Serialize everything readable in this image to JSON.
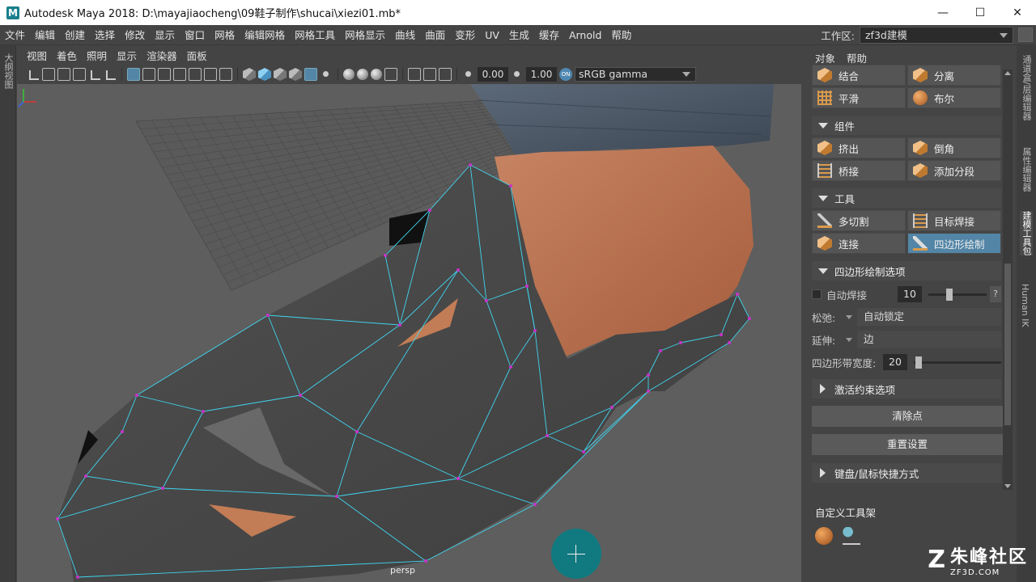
{
  "window": {
    "app_icon": "M",
    "title": "Autodesk Maya 2018: D:\\mayajiaocheng\\09鞋子制作\\shucai\\xiezi01.mb*",
    "controls": [
      "minimize-icon",
      "maximize-icon",
      "close-icon"
    ]
  },
  "menubar": {
    "items": [
      "文件",
      "编辑",
      "创建",
      "选择",
      "修改",
      "显示",
      "窗口",
      "网格",
      "编辑网格",
      "网格工具",
      "网格显示",
      "曲线",
      "曲面",
      "变形",
      "UV",
      "生成",
      "缓存",
      "Arnold",
      "帮助"
    ],
    "workspace_label": "工作区:",
    "workspace_value": "zf3d建模"
  },
  "left_strip": {
    "tab": "大纲视图"
  },
  "viewport": {
    "menu": [
      "视图",
      "着色",
      "照明",
      "显示",
      "渲染器",
      "面板"
    ],
    "exposure": "0.00",
    "gamma": "1.00",
    "color_space": "sRGB gamma",
    "camera_label": "persp"
  },
  "right_panel": {
    "menu": [
      "对象",
      "帮助"
    ],
    "object_tools": [
      {
        "label": "结合",
        "icon": "combine-icon"
      },
      {
        "label": "分离",
        "icon": "separate-icon"
      },
      {
        "label": "平滑",
        "icon": "smooth-icon"
      },
      {
        "label": "布尔",
        "icon": "boolean-icon"
      }
    ],
    "components_title": "组件",
    "component_tools": [
      {
        "label": "挤出",
        "icon": "extrude-icon"
      },
      {
        "label": "倒角",
        "icon": "bevel-icon"
      },
      {
        "label": "桥接",
        "icon": "bridge-icon"
      },
      {
        "label": "添加分段",
        "icon": "add-divisions-icon"
      }
    ],
    "tools_title": "工具",
    "tools": [
      {
        "label": "多切割",
        "icon": "multi-cut-icon"
      },
      {
        "label": "目标焊接",
        "icon": "target-weld-icon"
      },
      {
        "label": "连接",
        "icon": "connect-icon"
      },
      {
        "label": "四边形绘制",
        "icon": "quad-draw-icon",
        "active": true
      }
    ],
    "quad_draw_options_title": "四边形绘制选项",
    "auto_weld": {
      "label": "自动焊接",
      "value": "10",
      "checked": false,
      "slider_fraction": 0.3
    },
    "relax": {
      "label": "松弛:",
      "value": "自动锁定"
    },
    "extend": {
      "label": "延伸:",
      "value": "边"
    },
    "strip_width": {
      "label": "四边形带宽度:",
      "value": "20",
      "slider_fraction": 0.02
    },
    "constraints_title": "激活约束选项",
    "clear_button": "清除点",
    "reset_button": "重置设置",
    "shortcuts_title": "键盘/鼠标快捷方式",
    "custom_shelf_title": "自定义工具架"
  },
  "right_tabs": [
    "通道盒/层编辑器",
    "属性编辑器",
    "建模工具包",
    "Human IK"
  ],
  "watermark": {
    "name": "朱峰社区",
    "url": "ZF3D.COM"
  },
  "colors": {
    "accent_blue": "#5285a6",
    "wire_cyan": "#3fd6f0",
    "vertex_magenta": "#c832c8",
    "cursor_teal": "#117a80"
  }
}
